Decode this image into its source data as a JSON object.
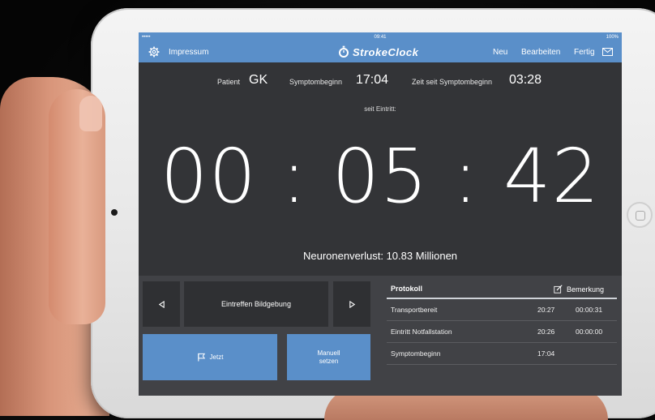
{
  "status": {
    "carrier": "•••••",
    "time": "09:41",
    "battery": "100%"
  },
  "navbar": {
    "impressum": "Impressum",
    "app_title": "StrokeClock",
    "neu": "Neu",
    "bearbeiten": "Bearbeiten",
    "fertig": "Fertig"
  },
  "info": {
    "patient_label": "Patient",
    "patient_value": "GK",
    "symptombeginn_label": "Symptombeginn",
    "symptombeginn_value": "17:04",
    "zeit_label": "Zeit seit Symptombeginn",
    "zeit_value": "03:28"
  },
  "seit_eintritt": "seit Eintritt:",
  "timer": "00 : 05 : 42",
  "neuronenverlust": "Neuronenverlust: 10.83 Millionen",
  "controls": {
    "event_label": "Eintreffen Bildgebung",
    "jetzt_label": "Jetzt",
    "manuell_line1": "Manuell",
    "manuell_line2": "setzen"
  },
  "protokoll": {
    "title": "Protokoll",
    "bemerkung": "Bemerkung",
    "rows": [
      {
        "name": "Transportbereit",
        "time": "20:27",
        "duration": "00:00:31"
      },
      {
        "name": "Eintritt Notfallstation",
        "time": "20:26",
        "duration": "00:00:00"
      },
      {
        "name": "Symptombeginn",
        "time": "17:04",
        "duration": ""
      }
    ]
  },
  "colors": {
    "accent": "#5a8fc9",
    "screen_bg": "#333437",
    "panel_bg": "#414246"
  },
  "icons": {
    "settings": "gear-icon",
    "logo": "stopwatch-icon",
    "mail": "mail-icon",
    "prev": "triangle-left-icon",
    "next": "triangle-right-icon",
    "flag": "flag-icon",
    "note": "edit-icon"
  }
}
